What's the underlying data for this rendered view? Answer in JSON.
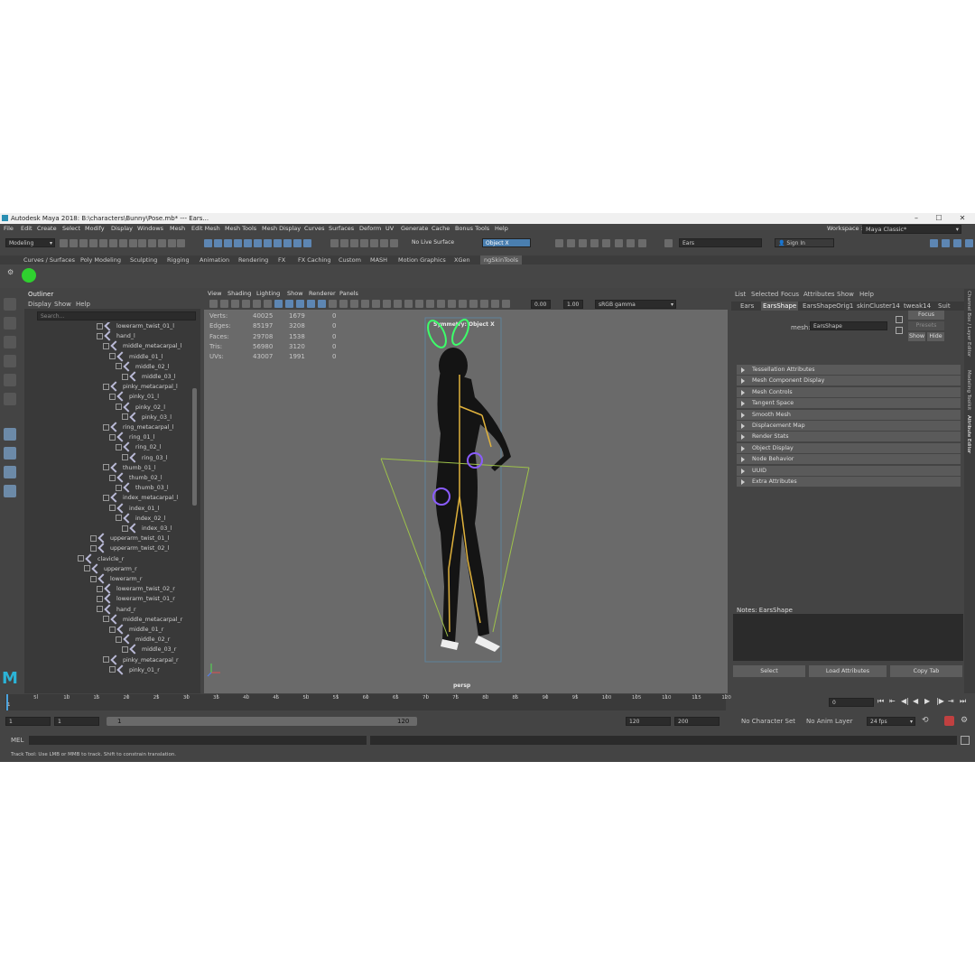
{
  "window": {
    "title": "Autodesk Maya 2018: B:\\characters\\Bunny\\Pose.mb*  ---  Ears..."
  },
  "menu": [
    "File",
    "Edit",
    "Create",
    "Select",
    "Modify",
    "Display",
    "Windows",
    "Mesh",
    "Edit Mesh",
    "Mesh Tools",
    "Mesh Display",
    "Curves",
    "Surfaces",
    "Deform",
    "UV",
    "Generate",
    "Cache",
    "Bonus Tools",
    "Help"
  ],
  "workspace": {
    "label": "Workspace :",
    "value": "Maya Classic*"
  },
  "status": {
    "mode": "Modeling",
    "live_surface": "No Live Surface",
    "symmetry": "Object X",
    "search_value": "Ears",
    "sign_in": "Sign In"
  },
  "shelf_tabs": [
    "Curves / Surfaces",
    "Poly Modeling",
    "Sculpting",
    "Rigging",
    "Animation",
    "Rendering",
    "FX",
    "FX Caching",
    "Custom",
    "MASH",
    "Motion Graphics",
    "XGen",
    "ngSkinTools"
  ],
  "outliner": {
    "title": "Outliner",
    "menu": [
      "Display",
      "Show",
      "Help"
    ],
    "search_placeholder": "Search...",
    "rows": [
      {
        "label": "lowerarm_twist_01_l",
        "indent": 80
      },
      {
        "label": "hand_l",
        "indent": 80
      },
      {
        "label": "middle_metacarpal_l",
        "indent": 87
      },
      {
        "label": "middle_01_l",
        "indent": 94
      },
      {
        "label": "middle_02_l",
        "indent": 101
      },
      {
        "label": "middle_03_l",
        "indent": 108
      },
      {
        "label": "pinky_metacarpal_l",
        "indent": 87
      },
      {
        "label": "pinky_01_l",
        "indent": 94
      },
      {
        "label": "pinky_02_l",
        "indent": 101
      },
      {
        "label": "pinky_03_l",
        "indent": 108
      },
      {
        "label": "ring_metacarpal_l",
        "indent": 87
      },
      {
        "label": "ring_01_l",
        "indent": 94
      },
      {
        "label": "ring_02_l",
        "indent": 101
      },
      {
        "label": "ring_03_l",
        "indent": 108
      },
      {
        "label": "thumb_01_l",
        "indent": 87
      },
      {
        "label": "thumb_02_l",
        "indent": 94
      },
      {
        "label": "thumb_03_l",
        "indent": 101
      },
      {
        "label": "index_metacarpal_l",
        "indent": 87
      },
      {
        "label": "index_01_l",
        "indent": 94
      },
      {
        "label": "index_02_l",
        "indent": 101
      },
      {
        "label": "index_03_l",
        "indent": 108
      },
      {
        "label": "upperarm_twist_01_l",
        "indent": 73
      },
      {
        "label": "upperarm_twist_02_l",
        "indent": 73
      },
      {
        "label": "clavicle_r",
        "indent": 59
      },
      {
        "label": "upperarm_r",
        "indent": 66
      },
      {
        "label": "lowerarm_r",
        "indent": 73
      },
      {
        "label": "lowerarm_twist_02_r",
        "indent": 80
      },
      {
        "label": "lowerarm_twist_01_r",
        "indent": 80
      },
      {
        "label": "hand_r",
        "indent": 80
      },
      {
        "label": "middle_metacarpal_r",
        "indent": 87
      },
      {
        "label": "middle_01_r",
        "indent": 94
      },
      {
        "label": "middle_02_r",
        "indent": 101
      },
      {
        "label": "middle_03_r",
        "indent": 108
      },
      {
        "label": "pinky_metacarpal_r",
        "indent": 87
      },
      {
        "label": "pinky_01_r",
        "indent": 94
      }
    ]
  },
  "viewport": {
    "menu": [
      "View",
      "Shading",
      "Lighting",
      "Show",
      "Renderer",
      "Panels"
    ],
    "exposure": "0.00",
    "gamma": "1.00",
    "color_space": "sRGB gamma",
    "symmetry_label": "Symmetry: Object X",
    "camera": "persp",
    "hud": [
      {
        "label": "Verts:",
        "a": "40025",
        "b": "1679",
        "c": "0"
      },
      {
        "label": "Edges:",
        "a": "85197",
        "b": "3208",
        "c": "0"
      },
      {
        "label": "Faces:",
        "a": "29708",
        "b": "1538",
        "c": "0"
      },
      {
        "label": "Tris:",
        "a": "56980",
        "b": "3120",
        "c": "0"
      },
      {
        "label": "UVs:",
        "a": "43007",
        "b": "1991",
        "c": "0"
      }
    ]
  },
  "attribute_editor": {
    "menu": [
      "List",
      "Selected",
      "Focus",
      "Attributes",
      "Show",
      "Help"
    ],
    "tabs": [
      "Ears",
      "EarsShape",
      "EarsShapeOrig1",
      "skinCluster14",
      "tweak14",
      "Suit"
    ],
    "active_tab": "EarsShape",
    "mesh_label": "mesh:",
    "mesh_value": "EarsShape",
    "focus": "Focus",
    "presets": "Presets",
    "show": "Show",
    "hide": "Hide",
    "sections": [
      "Tessellation Attributes",
      "Mesh Component Display",
      "Mesh Controls",
      "Tangent Space",
      "Smooth Mesh",
      "Displacement Map",
      "Render Stats",
      "Object Display",
      "Node Behavior",
      "UUID",
      "Extra Attributes"
    ],
    "notes_label": "Notes:  EarsShape",
    "buttons": [
      "Select",
      "Load Attributes",
      "Copy Tab"
    ]
  },
  "side_tabs": [
    "Channel Box / Layer Editor",
    "Modeling Toolkit",
    "Attribute Editor"
  ],
  "timeline": {
    "ticks": [
      "5",
      "10",
      "15",
      "20",
      "25",
      "30",
      "35",
      "40",
      "45",
      "50",
      "55",
      "60",
      "65",
      "70",
      "75",
      "80",
      "85",
      "90",
      "95",
      "100",
      "105",
      "110",
      "115",
      "120"
    ],
    "start_tick": "1",
    "current_frame": "0"
  },
  "range": {
    "start": "1",
    "inner_start": "1",
    "slider_start": "1",
    "slider_end": "120",
    "end": "120",
    "anim_end": "200",
    "character": "No Character Set",
    "anim_layer": "No Anim Layer",
    "fps": "24 fps"
  },
  "command": {
    "label": "MEL"
  },
  "help_line": "Track Tool: Use LMB or MMB to track. Shift to constrain translation."
}
